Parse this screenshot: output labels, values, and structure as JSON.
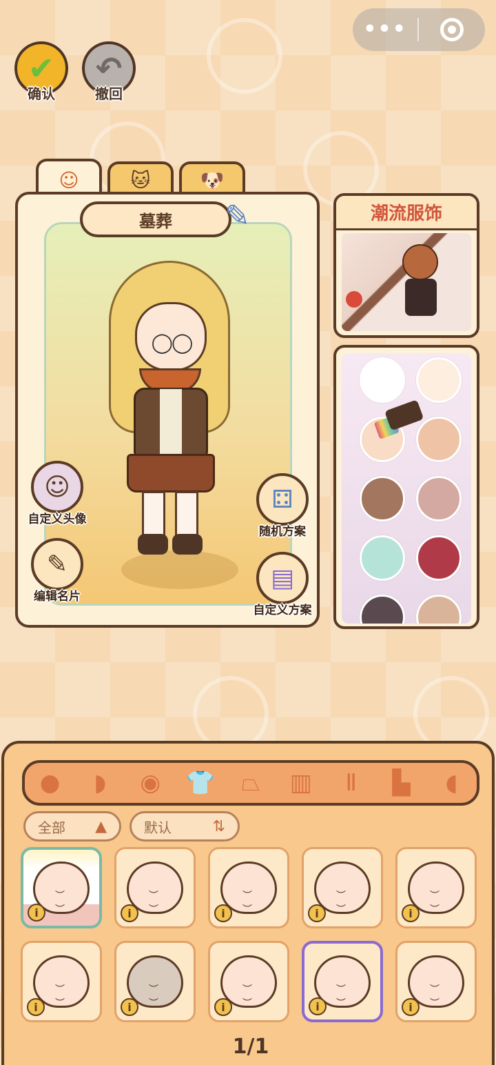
{
  "capsule": {
    "more_icon": "more-dots-icon",
    "target_icon": "target-icon",
    "more_glyph": "•••"
  },
  "toolbar": {
    "confirm": {
      "label": "确认",
      "icon": "checkmark-icon",
      "glyph": "✔"
    },
    "undo": {
      "label": "撤回",
      "icon": "undo-arrow-icon",
      "glyph": "↶"
    }
  },
  "tabs": [
    {
      "icon": "girl-face-icon",
      "glyph": "☺",
      "active": true
    },
    {
      "icon": "cat-face-icon",
      "glyph": "🐱",
      "active": false
    },
    {
      "icon": "dog-face-icon",
      "glyph": "🐶",
      "active": false
    }
  ],
  "character": {
    "name": "墓葬",
    "edit_icon": "pencil-icon"
  },
  "actions": {
    "custom_avatar": {
      "label": "自定义头像",
      "icon": "avatar-icon"
    },
    "edit_card": {
      "label": "编辑名片",
      "icon": "edit-card-icon"
    },
    "random_plan": {
      "label": "随机方案",
      "icon": "dice-icon"
    },
    "custom_plan": {
      "label": "自定义方案",
      "icon": "outfit-cards-icon"
    }
  },
  "fashion": {
    "title": "潮流服饰"
  },
  "palette": {
    "colors": [
      "#ffffff",
      "#fdeee0",
      "#f9dcc6",
      "#efc3a6",
      "#a3765f",
      "#d3a9a1",
      "#b6e3d8",
      "#b03a48",
      "#5a4a4f",
      "#d9b49b"
    ],
    "brush_icon": "paint-brush-icon"
  },
  "categories": [
    {
      "icon": "face-shape-icon",
      "glyph": "●"
    },
    {
      "icon": "hair-icon",
      "glyph": "◗"
    },
    {
      "icon": "eye-icon",
      "glyph": "◉"
    },
    {
      "icon": "shirt-icon",
      "glyph": "👕"
    },
    {
      "icon": "skirt-icon",
      "glyph": "⏢"
    },
    {
      "icon": "coat-icon",
      "glyph": "▥"
    },
    {
      "icon": "pants-icon",
      "glyph": "Ⅱ"
    },
    {
      "icon": "shoe-icon",
      "glyph": "▙"
    },
    {
      "icon": "accessory-icon",
      "glyph": "◖"
    }
  ],
  "filters": {
    "scope": {
      "label": "全部",
      "arrow": "▲"
    },
    "sort": {
      "label": "默认",
      "arrow": "⇅"
    }
  },
  "items": [
    {
      "eyes": "︶ ︶",
      "grey": false
    },
    {
      "eyes": "︶ ︶",
      "grey": false
    },
    {
      "eyes": "︶ ︶",
      "grey": false
    },
    {
      "eyes": "︶ ︶",
      "grey": false
    },
    {
      "eyes": "︶ ︶",
      "grey": false
    },
    {
      "eyes": "︶ ︶",
      "grey": false
    },
    {
      "eyes": "︶ ︶",
      "grey": true
    },
    {
      "eyes": "︶ ︶",
      "grey": false
    },
    {
      "eyes": "︶ ︶",
      "grey": false
    },
    {
      "eyes": "︶ ︶",
      "grey": false
    }
  ],
  "item_info_glyph": "i",
  "pagination": {
    "text": "1/1"
  }
}
